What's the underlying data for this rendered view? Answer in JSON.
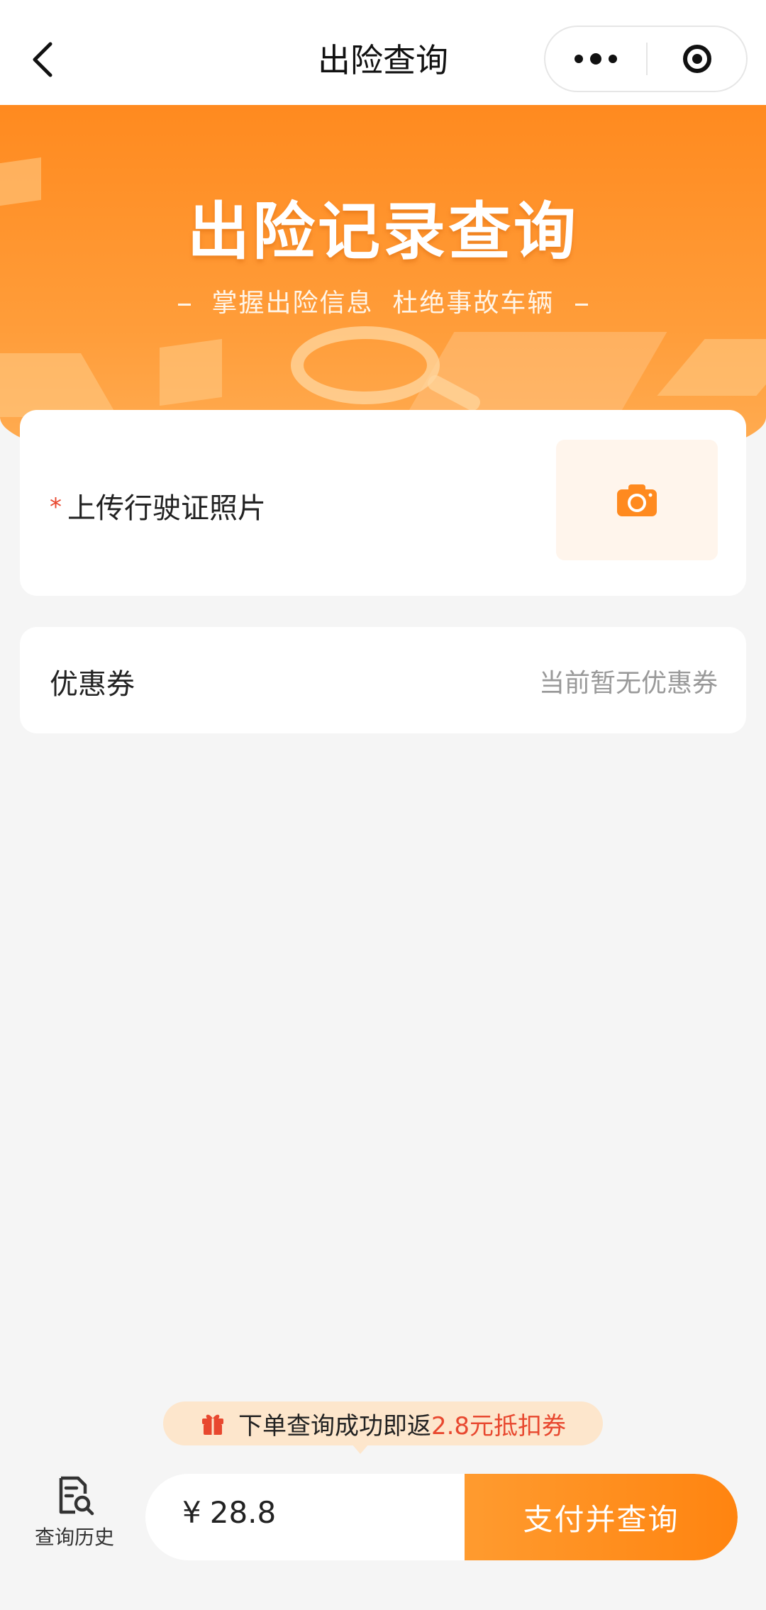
{
  "nav": {
    "title": "出险查询"
  },
  "banner": {
    "title": "出险记录查询",
    "subtitle": "掌握出险信息  杜绝事故车辆"
  },
  "upload": {
    "required_mark": "*",
    "label": "上传行驶证照片",
    "icon": "camera-icon"
  },
  "coupon": {
    "label": "优惠券",
    "value": "当前暂无优惠券"
  },
  "promo": {
    "text": "下单查询成功即返",
    "highlight": "2.8元抵扣券",
    "icon": "gift-icon"
  },
  "bottom": {
    "history_label": "查询历史",
    "currency": "¥",
    "price": "28.8",
    "pay_label": "支付并查询"
  },
  "colors": {
    "accent": "#ff8a1f",
    "highlight": "#e8482f",
    "background": "#f5f5f5"
  }
}
